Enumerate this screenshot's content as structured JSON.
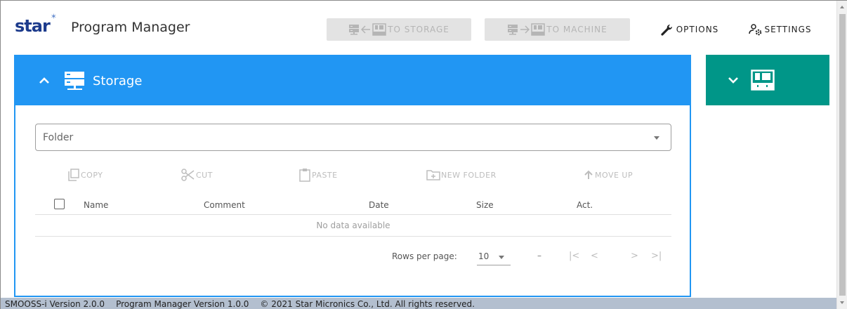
{
  "app": {
    "logo_text": "star",
    "title": "Program Manager"
  },
  "header": {
    "to_storage_label": "TO STORAGE",
    "to_machine_label": "TO MACHINE",
    "options_label": "OPTIONS",
    "settings_label": "SETTINGS"
  },
  "storage": {
    "title": "Storage",
    "folder_placeholder": "Folder",
    "toolbar": {
      "copy": "COPY",
      "cut": "CUT",
      "paste": "PASTE",
      "new_folder": "NEW FOLDER",
      "move_up": "MOVE UP"
    },
    "table": {
      "columns": [
        "Name",
        "Comment",
        "Date",
        "Size",
        "Act."
      ],
      "empty_text": "No data available"
    },
    "pagination": {
      "rows_per_page_label": "Rows per page:",
      "rows_per_page_value": "10",
      "range_text": "–"
    }
  },
  "statusbar": {
    "smooss_version": "SMOOSS-i Version 2.0.0",
    "pm_version": "Program Manager Version 1.0.0",
    "copyright": "© 2021 Star Micronics Co., Ltd. All rights reserved."
  },
  "colors": {
    "storage_accent": "#2196f3",
    "machine_accent": "#009688",
    "logo_blue": "#1d3b8c",
    "statusbar_bg": "#b3bfcf"
  },
  "icons": [
    "server-icon",
    "machine-icon",
    "wrench-icon",
    "settings-icon",
    "copy-icon",
    "cut-icon",
    "paste-icon",
    "new-folder-icon",
    "arrow-up-icon",
    "chevron-up-icon",
    "chevron-down-icon"
  ]
}
